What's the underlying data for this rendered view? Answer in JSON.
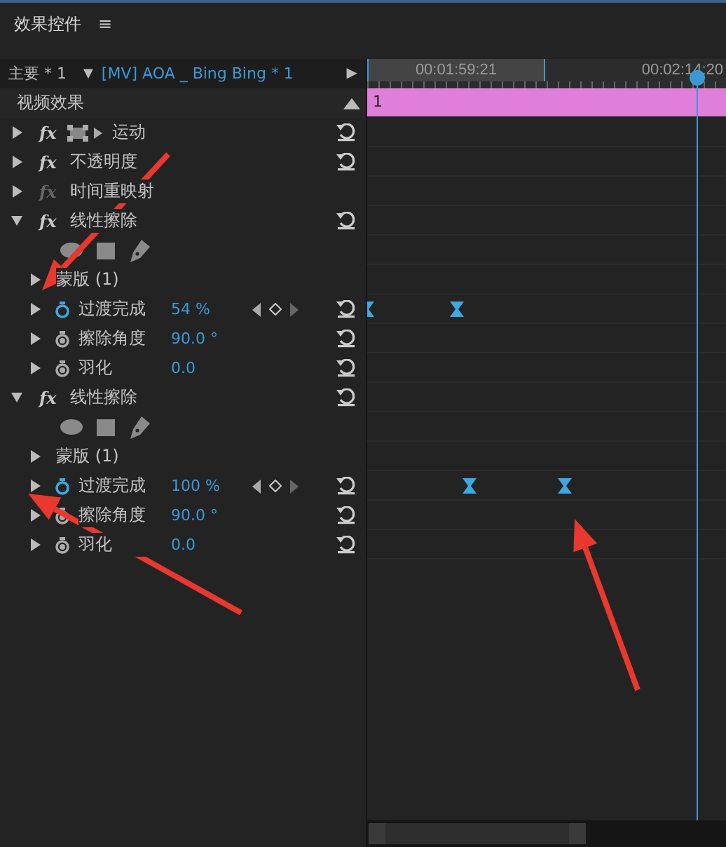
{
  "panel": {
    "title": "效果控件",
    "menu_icon": "≡"
  },
  "source": {
    "master": "主要 * 1",
    "dropdown": "▼",
    "clip": "[MV] AOA _ Bing Bing * 1",
    "play": "▶"
  },
  "ruler": {
    "labels": [
      "00:01:59:21",
      "00:02:14:20"
    ]
  },
  "clip": {
    "label": "1"
  },
  "section": {
    "title": "视频效果"
  },
  "effects": [
    {
      "fx": "fx",
      "name": "运动",
      "kind": "motion",
      "fx_enabled": true,
      "expanded": false,
      "resettable": true
    },
    {
      "fx": "fx",
      "name": "不透明度",
      "kind": "plain",
      "fx_enabled": true,
      "expanded": false,
      "resettable": true
    },
    {
      "fx": "fx",
      "name": "时间重映射",
      "kind": "plain",
      "fx_enabled": false,
      "expanded": false,
      "resettable": false
    },
    {
      "fx": "fx",
      "name": "线性擦除",
      "kind": "plain",
      "fx_enabled": true,
      "expanded": true,
      "resettable": true,
      "children": [
        {
          "kind": "shapes"
        },
        {
          "kind": "group",
          "label": "蒙版 (1)",
          "expanded": false
        },
        {
          "kind": "param",
          "label": "过渡完成",
          "value": "54 %",
          "animated": true,
          "expanded": false,
          "keyframes": [
            {
              "level": 0.0
            },
            {
              "level": 0.25
            }
          ]
        },
        {
          "kind": "param",
          "label": "擦除角度",
          "value": "90.0 °",
          "animated": false,
          "expanded": false
        },
        {
          "kind": "param",
          "label": "羽化",
          "value": "0.0",
          "animated": false,
          "expanded": false
        }
      ]
    },
    {
      "fx": "fx",
      "name": "线性擦除",
      "kind": "plain",
      "fx_enabled": true,
      "expanded": true,
      "resettable": true,
      "children": [
        {
          "kind": "shapes"
        },
        {
          "kind": "group",
          "label": "蒙版 (1)",
          "expanded": false
        },
        {
          "kind": "param",
          "label": "过渡完成",
          "value": "100 %",
          "animated": true,
          "expanded": false,
          "keyframes": [
            {
              "level": 0.285
            },
            {
              "level": 0.55
            }
          ]
        },
        {
          "kind": "param",
          "label": "擦除角度",
          "value": "90.0 °",
          "animated": false,
          "expanded": false
        },
        {
          "kind": "param",
          "label": "羽化",
          "value": "0.0",
          "animated": false,
          "expanded": false
        }
      ]
    }
  ]
}
